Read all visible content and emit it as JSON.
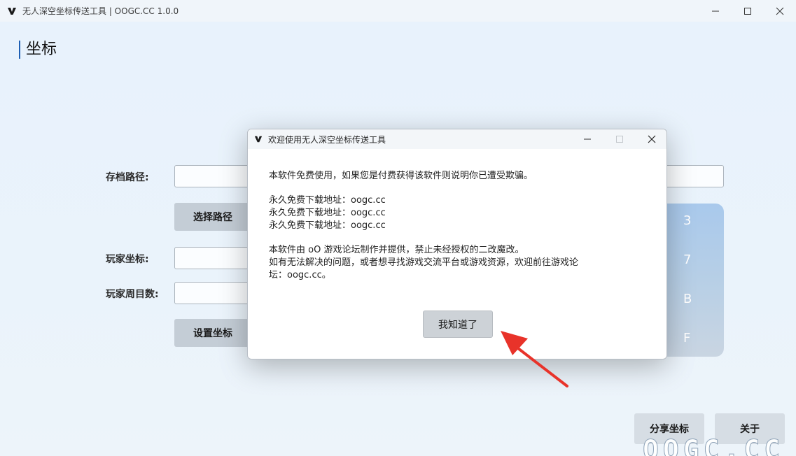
{
  "window": {
    "title": "无人深空坐标传送工具 | OOGC.CC 1.0.0"
  },
  "page": {
    "title": "坐标"
  },
  "form": {
    "save_path_label": "存档路径:",
    "choose_path_button": "选择路径",
    "player_coord_label": "玩家坐标:",
    "player_cycle_label": "玩家周目数:",
    "set_coord_button": "设置坐标"
  },
  "keypad": {
    "keys": [
      "3",
      "7",
      "B",
      "F"
    ]
  },
  "footer": {
    "share_button": "分享坐标",
    "about_button": "关于"
  },
  "watermark": {
    "text": "OOGC.CC"
  },
  "dialog": {
    "title": "欢迎使用无人深空坐标传送工具",
    "line1": "本软件免费使用，如果您是付费获得该软件则说明你已遭受欺骗。",
    "download_lines": [
      "永久免费下载地址：oogc.cc",
      "永久免费下载地址：oogc.cc",
      "永久免费下载地址：oogc.cc"
    ],
    "line_made_by": "本软件由 oO 游戏论坛制作并提供，禁止未经授权的二改魔改。",
    "line_help_1": "如有无法解决的问题，或者想寻找游戏交流平台或游戏资源，欢迎前往游戏论",
    "line_help_2": "坛：oogc.cc。",
    "ok_button": "我知道了"
  },
  "colors": {
    "accent": "#1e5fb4",
    "arrow": "#e8332a",
    "background": "#eaf3fb"
  }
}
